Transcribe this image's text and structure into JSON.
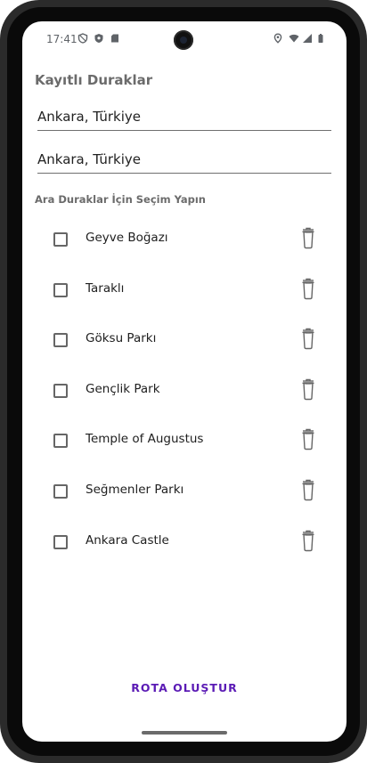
{
  "status_bar": {
    "time": "17:41",
    "left_icons": [
      "vpn-shield-icon",
      "shield-icon",
      "sd-card-icon"
    ],
    "right_icons": [
      "location-icon",
      "wifi-icon",
      "signal-icon",
      "battery-icon"
    ]
  },
  "page": {
    "title": "Kayıtlı Duraklar",
    "origin_value": "Ankara, Türkiye",
    "destination_value": "Ankara, Türkiye",
    "subtitle": "Ara Duraklar İçin Seçim Yapın"
  },
  "stops": [
    {
      "label": "Geyve Boğazı",
      "checked": false
    },
    {
      "label": "Taraklı",
      "checked": false
    },
    {
      "label": "Göksu Parkı",
      "checked": false
    },
    {
      "label": "Gençlik Park",
      "checked": false
    },
    {
      "label": "Temple of Augustus",
      "checked": false
    },
    {
      "label": "Seğmenler Parkı",
      "checked": false
    },
    {
      "label": "Ankara Castle",
      "checked": false
    }
  ],
  "actions": {
    "create_route_label": "ROTA OLUŞTUR"
  },
  "colors": {
    "accent": "#5b1bb5",
    "text_muted": "#6b6b6b"
  }
}
